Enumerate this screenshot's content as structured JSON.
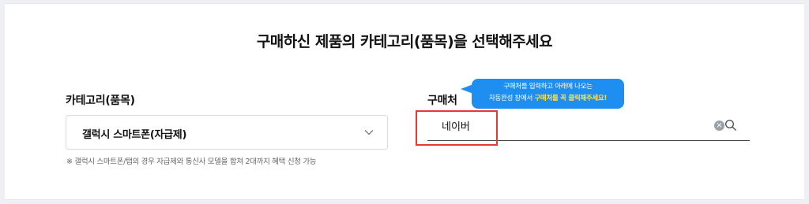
{
  "page": {
    "title": "구매하신 제품의 카테고리(품목)을 선택해주세요"
  },
  "category": {
    "label": "카테고리(품목)",
    "selected": "갤럭시 스마트폰(자급제)",
    "note": "※ 갤럭시 스마트폰/탭의 경우 자급제와 통신사 모델을 합쳐 2대까지 혜택 신청 가능"
  },
  "vendor": {
    "label": "구매처",
    "value": "네이버",
    "tooltip_line1": "구매처를 입력하고 아래에 나오는",
    "tooltip_line2_prefix": "자동완성 창에서 ",
    "tooltip_line2_highlight": "구매처를 꼭 클릭해주세요!"
  },
  "colors": {
    "accent": "#1f8ef1",
    "highlight": "#e53935",
    "tooltip_emphasis": "#ffe24a"
  },
  "icons": {
    "dropdown": "chevron-down-icon",
    "clear": "clear-icon",
    "search": "search-icon"
  }
}
